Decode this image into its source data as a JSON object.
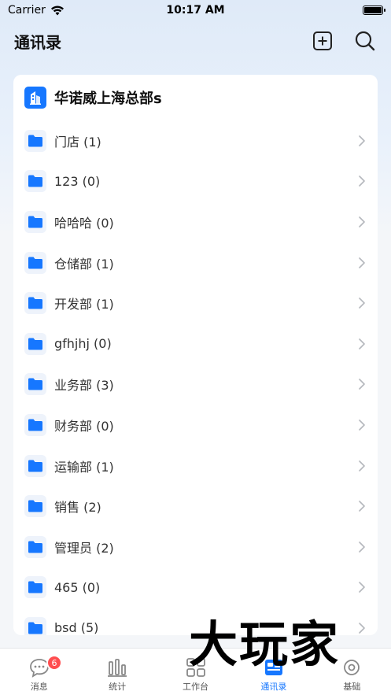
{
  "status": {
    "carrier": "Carrier",
    "time": "10:17 AM"
  },
  "nav": {
    "title": "通讯录"
  },
  "org": {
    "name": "华诺威上海总部s"
  },
  "departments": [
    {
      "label": "门店 (1)"
    },
    {
      "label": "123 (0)"
    },
    {
      "label": "哈哈哈 (0)"
    },
    {
      "label": "仓储部 (1)"
    },
    {
      "label": "开发部 (1)"
    },
    {
      "label": "gfhjhj (0)"
    },
    {
      "label": "业务部 (3)"
    },
    {
      "label": "财务部 (0)"
    },
    {
      "label": "运输部 (1)"
    },
    {
      "label": "销售 (2)"
    },
    {
      "label": "管理员 (2)"
    },
    {
      "label": "465 (0)"
    },
    {
      "label": "bsd (5)"
    }
  ],
  "tabs": [
    {
      "label": "消息",
      "icon": "chat-icon",
      "badge": "6"
    },
    {
      "label": "统计",
      "icon": "bar-chart-icon"
    },
    {
      "label": "工作台",
      "icon": "grid-icon"
    },
    {
      "label": "通讯录",
      "icon": "contacts-icon",
      "active": true
    },
    {
      "label": "基础",
      "icon": "settings-icon"
    }
  ],
  "watermark": "大玩家",
  "colors": {
    "accent": "#1677ff",
    "badge": "#ff4d4f"
  }
}
